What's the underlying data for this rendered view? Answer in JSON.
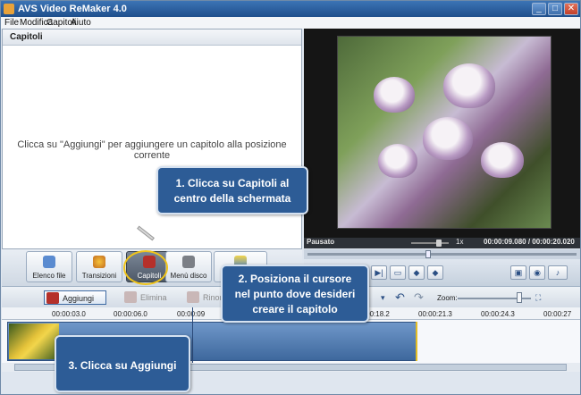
{
  "window": {
    "title": "AVS Video ReMaker 4.0"
  },
  "menu": [
    "File",
    "Modifica",
    "Capitoli",
    "Aiuto"
  ],
  "chapters": {
    "header": "Capitoli",
    "hint": "Clicca su \"Aggiungi\" per aggiungere un capitolo alla posizione corrente"
  },
  "playback": {
    "status": "Pausato",
    "speed": "1x",
    "time": "00:00:09.080 / 00:00:20.020"
  },
  "toolbar": [
    {
      "label": "Elenco file",
      "icon": "file-list-icon"
    },
    {
      "label": "Transizioni",
      "icon": "transitions-icon"
    },
    {
      "label": "Capitoli",
      "icon": "chapters-icon"
    },
    {
      "label": "Menù disco",
      "icon": "disc-menu-icon"
    }
  ],
  "timeline_toolbar": {
    "add": "Aggiungi",
    "delete": "Elimina",
    "rename": "Rinom",
    "zoom": "Zoom:"
  },
  "ruler_ticks": [
    "00:00:03.0",
    "00:00:06.0",
    "00:00:09",
    "00:00:18.2",
    "00:00:21.3",
    "00:00:24.3",
    "00:00:27"
  ],
  "callouts": {
    "c1": [
      "1. Clicca su Capitoli al",
      "centro della schermata"
    ],
    "c2": [
      "2. Posiziona il cursore",
      "nel punto dove desideri",
      "creare il capitolo"
    ],
    "c3": [
      "3. Clicca su Aggiungi"
    ]
  },
  "colors": {
    "callout": "#2d5c96",
    "highlight": "#f0c419",
    "titlebar": "#1f4f8c"
  }
}
